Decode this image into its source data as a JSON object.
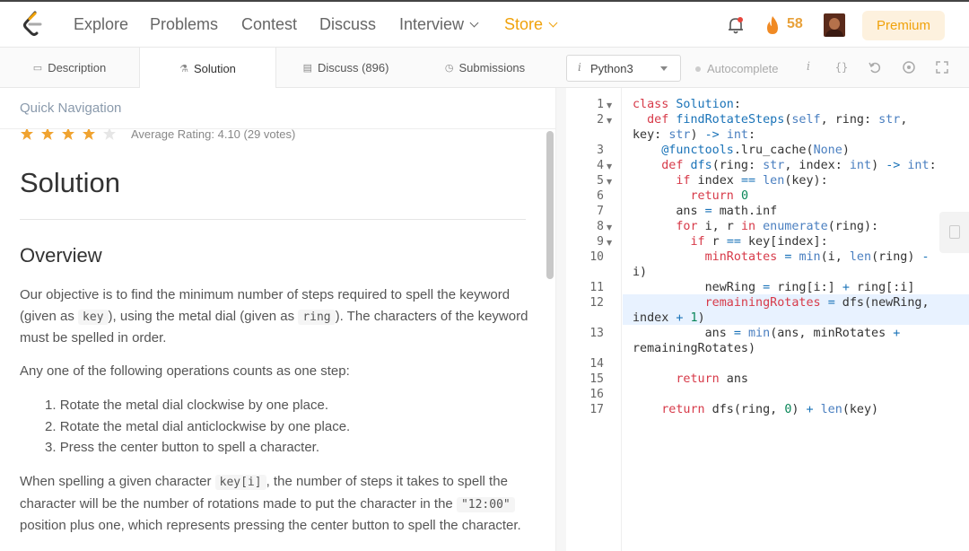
{
  "nav": {
    "links": [
      "Explore",
      "Problems",
      "Contest",
      "Discuss",
      "Interview",
      "Store"
    ],
    "streak_count": "58",
    "premium_label": "Premium",
    "accent_color": "#f0a20b"
  },
  "tabs": {
    "description": "Description",
    "solution": "Solution",
    "discuss": "Discuss (896)",
    "submissions": "Submissions"
  },
  "toolbar": {
    "language": "Python3",
    "autocomplete_label": "Autocomplete",
    "icons": [
      "info-icon",
      "braces-icon",
      "reset-icon",
      "settings-icon",
      "fullscreen-icon"
    ]
  },
  "article": {
    "quick_nav": "Quick Navigation",
    "rating_stars": 4,
    "rating_text": "Average Rating: 4.10 (29 votes)",
    "title": "Solution",
    "section": "Overview",
    "p1_a": "Our objective is to find the minimum number of steps required to spell the keyword (given as ",
    "p1_code1": "key",
    "p1_b": "), using the metal dial (given as ",
    "p1_code2": "ring",
    "p1_c": "). The characters of the keyword must be spelled in order.",
    "p2": "Any one of the following operations counts as one step:",
    "steps": [
      "Rotate the metal dial clockwise by one place.",
      "Rotate the metal dial anticlockwise by one place.",
      "Press the center button to spell a character."
    ],
    "p3_a": "When spelling a given character ",
    "p3_code1": "key[i]",
    "p3_b": ", the number of steps it takes to spell the character will be the number of rotations made to put the character in the ",
    "p3_code2": "\"12:00\"",
    "p3_c": " position plus one, which represents pressing the center button to spell the character."
  },
  "editor": {
    "line_numbers": [
      "1",
      "2",
      "3",
      "4",
      "5",
      "6",
      "7",
      "8",
      "9",
      "10",
      "11",
      "12",
      "13",
      "14",
      "15",
      "16",
      "17"
    ],
    "highlighted_line": "12"
  }
}
